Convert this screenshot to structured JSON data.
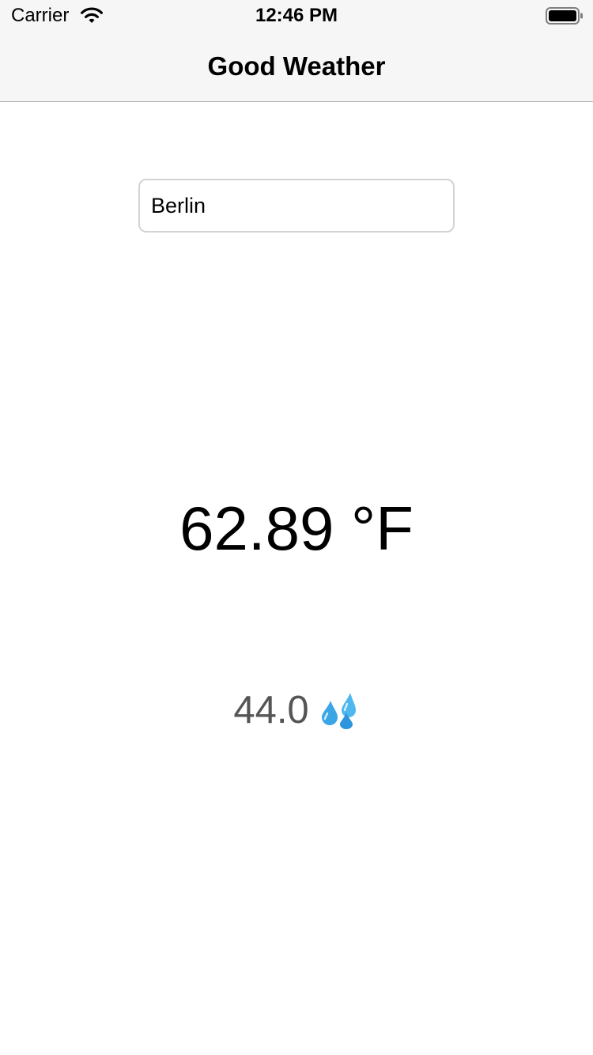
{
  "status_bar": {
    "carrier": "Carrier",
    "time": "12:46 PM",
    "wifi_icon": "wifi-icon",
    "battery_icon": "battery-icon"
  },
  "nav": {
    "title": "Good Weather"
  },
  "search": {
    "value": "Berlin",
    "placeholder": ""
  },
  "weather": {
    "temperature": "62.89 °F",
    "humidity": "44.0",
    "humidity_icon": "sweat-droplets-icon"
  },
  "colors": {
    "nav_background": "#f6f6f6",
    "nav_border": "#b2b2b2",
    "humidity_text": "#555555",
    "droplet_blue": "#4fb7ef"
  }
}
